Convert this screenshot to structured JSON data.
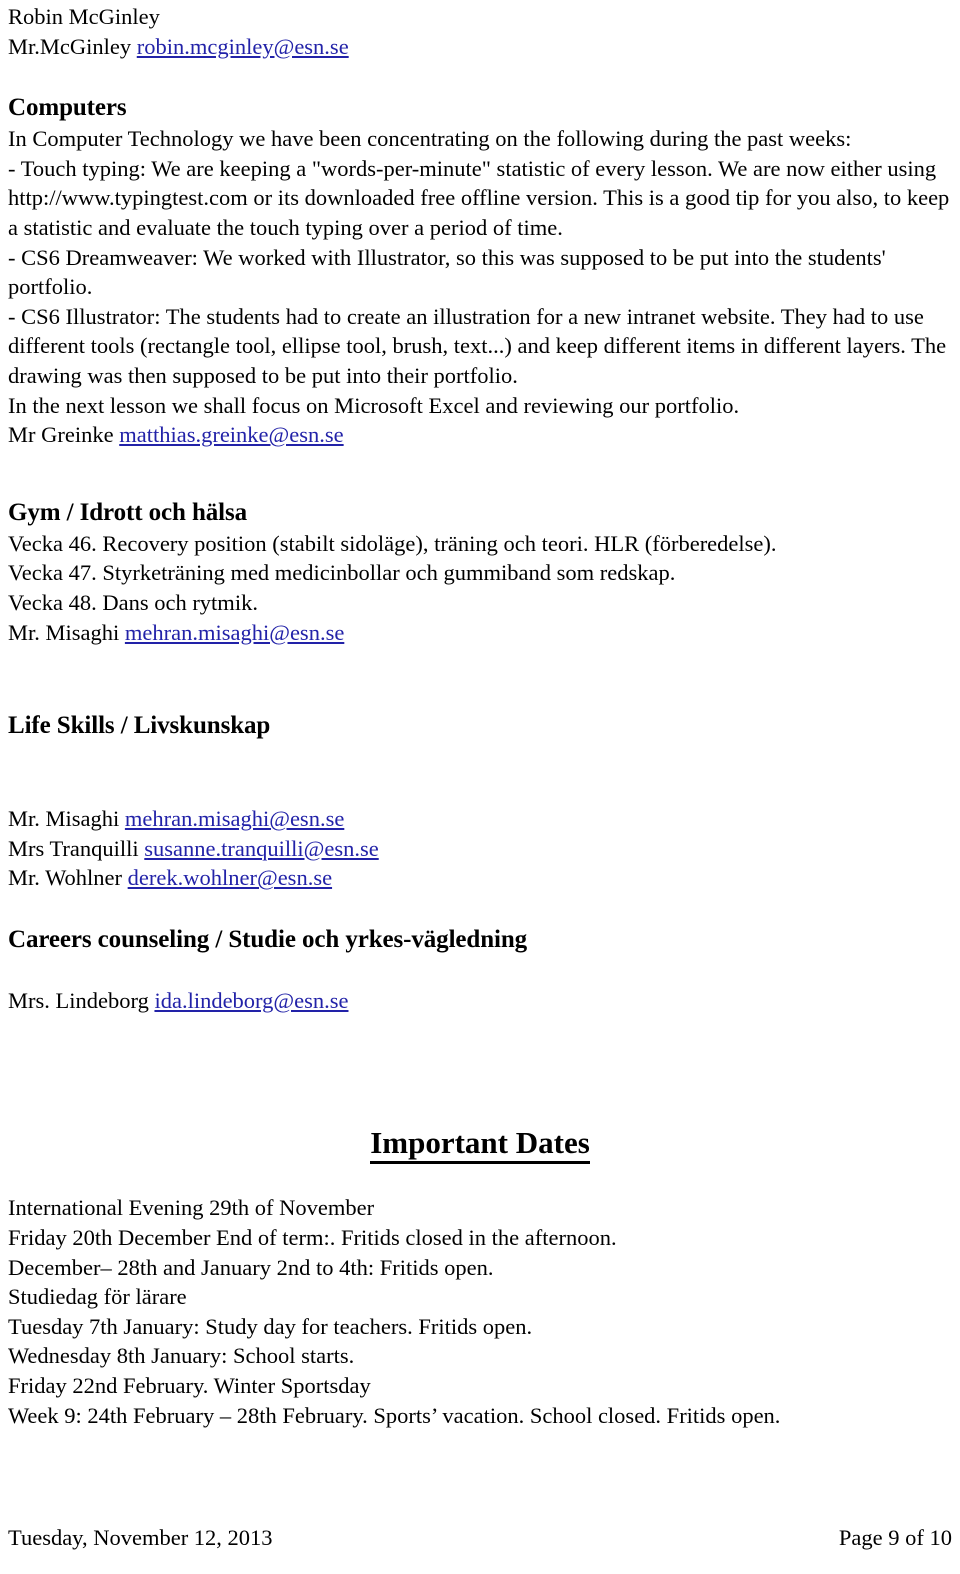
{
  "header": {
    "name_line": "Robin McGinley",
    "contact_prefix": "Mr.McGinley ",
    "contact_email": "robin.mcginley@esn.se"
  },
  "computers": {
    "heading": "Computers",
    "intro": " In Computer Technology we have been concentrating on the following during the past weeks:",
    "touch_typing": "- Touch typing: We are keeping a \"words-per-minute\" statistic of every lesson. We are now either using http://www.typingtest.com or its downloaded free offline version. This is a good tip for you also, to keep a statistic and evaluate the touch typing over a period of time.",
    "dreamweaver": "- CS6 Dreamweaver: We worked with Illustrator, so this was supposed to be put into the students' portfolio.",
    "illustrator": "- CS6 Illustrator: The students had to create an illustration for a new intranet website. They had to use different tools (rectangle tool, ellipse tool, brush, text...) and keep different items in different layers. The drawing was then supposed to be put into their portfolio.",
    "next_lesson": "In the next lesson we shall focus on Microsoft Excel and reviewing our portfolio.",
    "teacher_prefix": "Mr Greinke ",
    "teacher_email": "matthias.greinke@esn.se"
  },
  "gym": {
    "heading": "Gym / Idrott och hälsa",
    "weeks": [
      "Vecka 46. Recovery position (stabilt sidoläge), träning och teori. HLR (förberedelse).",
      "Vecka 47. Styrketräning med medicinbollar och gummiband som redskap.",
      "Vecka 48. Dans och rytmik."
    ],
    "teacher_prefix": "Mr. Misaghi ",
    "teacher_email": "mehran.misaghi@esn.se"
  },
  "life_skills": {
    "heading": "Life Skills / Livskunskap",
    "contacts": [
      {
        "prefix": "Mr. Misaghi ",
        "email": "mehran.misaghi@esn.se"
      },
      {
        "prefix": "Mrs Tranquilli ",
        "email": "susanne.tranquilli@esn.se"
      },
      {
        "prefix": "Mr. Wohlner ",
        "email": "derek.wohlner@esn.se"
      }
    ]
  },
  "careers": {
    "heading": "Careers counseling / Studie och yrkes-vägledning",
    "contact_prefix": "Mrs. Lindeborg ",
    "contact_email": "ida.lindeborg@esn.se"
  },
  "important_dates": {
    "heading": "Important Dates",
    "items": [
      "International Evening 29th of November",
      "Friday 20th  December End of term:. Fritids closed in the afternoon.",
      "December– 28th and January 2nd to 4th: Fritids open.",
      "Studiedag för lärare",
      "Tuesday 7th  January: Study day for teachers. Fritids open.",
      "Wednesday 8th January: School starts.",
      "Friday 22nd February. Winter Sportsday",
      "Week  9: 24th February – 28th February. Sports’ vacation. School closed. Fritids open."
    ]
  },
  "footer": {
    "date": "Tuesday, November 12, 2013",
    "page": "Page 9 of 10"
  },
  "colors": {
    "link": "#2222a8",
    "text": "#000000",
    "background": "#ffffff"
  }
}
